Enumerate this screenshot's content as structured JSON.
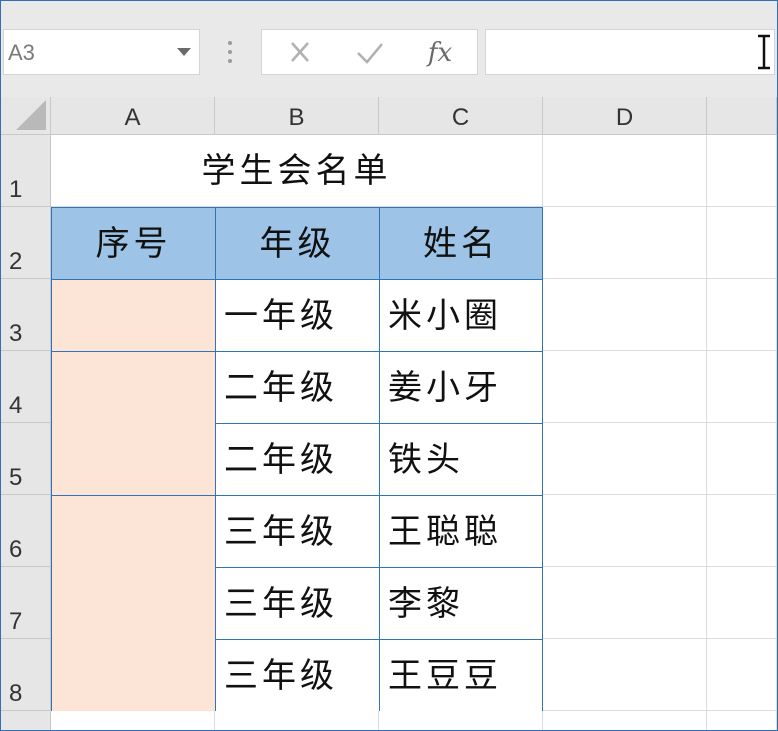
{
  "formula_bar": {
    "name_box": "A3",
    "cancel_icon": "x-icon",
    "enter_icon": "check-icon",
    "function_label": "fx",
    "formula": ""
  },
  "columns": [
    "A",
    "B",
    "C",
    "D"
  ],
  "rows": [
    "1",
    "2",
    "3",
    "4",
    "5",
    "6",
    "7",
    "8"
  ],
  "sheet": {
    "title": "学生会名单",
    "headers": {
      "serial": "序号",
      "grade": "年级",
      "name": "姓名"
    },
    "records": [
      {
        "grade": "一年级",
        "name": "米小圈"
      },
      {
        "grade": "二年级",
        "name": "姜小牙"
      },
      {
        "grade": "二年级",
        "name": "铁头"
      },
      {
        "grade": "三年级",
        "name": "王聪聪"
      },
      {
        "grade": "三年级",
        "name": "李黎"
      },
      {
        "grade": "三年级",
        "name": "王豆豆"
      }
    ]
  },
  "colors": {
    "header_fill": "#9dc3e6",
    "merged_fill": "#fce4d6",
    "border_blue": "#2f75b5"
  }
}
